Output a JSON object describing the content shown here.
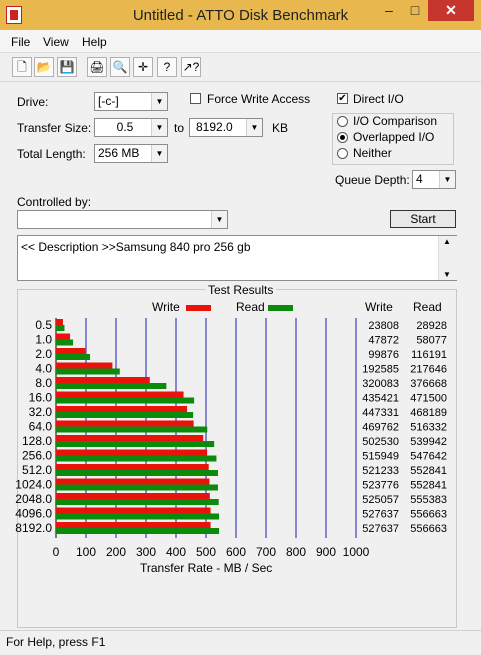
{
  "window": {
    "title": "Untitled - ATTO Disk Benchmark",
    "min": "–",
    "max": "□",
    "close": "✕"
  },
  "menu": [
    "File",
    "View",
    "Help"
  ],
  "toolbar": {
    "icons": [
      "new-icon",
      "open-icon",
      "save-icon",
      "print-icon",
      "print-preview-icon",
      "move-icon",
      "help-icon",
      "context-help-icon"
    ],
    "glyphs": [
      "🗋",
      "📂",
      "💾",
      "🖨",
      "🔍",
      "✛",
      "?",
      "↗?"
    ]
  },
  "form": {
    "drive_label": "Drive:",
    "drive_value": "[-c-]",
    "force_write_label": "Force Write Access",
    "force_write_checked": false,
    "direct_io_label": "Direct I/O",
    "direct_io_checked": true,
    "transfer_size_label": "Transfer Size:",
    "transfer_from": "0.5",
    "to_label": "to",
    "transfer_to": "8192.0",
    "kb_label": "KB",
    "total_length_label": "Total Length:",
    "total_length_value": "256 MB",
    "io_comparison_label": "I/O Comparison",
    "overlapped_io_label": "Overlapped I/O",
    "neither_label": "Neither",
    "selected_io": "Overlapped I/O",
    "queue_depth_label": "Queue Depth:",
    "queue_depth_value": "4",
    "controlled_by_label": "Controlled by:",
    "controlled_by_value": "",
    "start_label": "Start",
    "description": "<< Description >>Samsung 840 pro 256 gb"
  },
  "results": {
    "title": "Test Results",
    "write_legend": "Write",
    "read_legend": "Read",
    "write_col": "Write",
    "read_col": "Read",
    "xlabel": "Transfer Rate - MB / Sec",
    "colors": {
      "write": "#e8140c",
      "read": "#0b8a0b",
      "grid": "#1c1cb0"
    }
  },
  "chart_data": {
    "type": "bar",
    "orientation": "horizontal",
    "categories": [
      "0.5",
      "1.0",
      "2.0",
      "4.0",
      "8.0",
      "16.0",
      "32.0",
      "64.0",
      "128.0",
      "256.0",
      "512.0",
      "1024.0",
      "2048.0",
      "4096.0",
      "8192.0"
    ],
    "series": [
      {
        "name": "Write",
        "values": [
          23808,
          47872,
          99876,
          192585,
          320083,
          435421,
          447331,
          469762,
          502530,
          515949,
          521233,
          523776,
          525057,
          527637,
          527637
        ]
      },
      {
        "name": "Read",
        "values": [
          28928,
          58077,
          116191,
          217646,
          376668,
          471500,
          468189,
          516332,
          539942,
          547642,
          552841,
          552841,
          555383,
          556663,
          556663
        ]
      }
    ],
    "x_ticks": [
      "0",
      "100",
      "200",
      "300",
      "400",
      "500",
      "600",
      "700",
      "800",
      "900",
      "1000"
    ],
    "xlim": [
      0,
      1000
    ],
    "xlabel": "Transfer Rate - MB / Sec",
    "grid": true
  },
  "status": "For Help, press F1"
}
